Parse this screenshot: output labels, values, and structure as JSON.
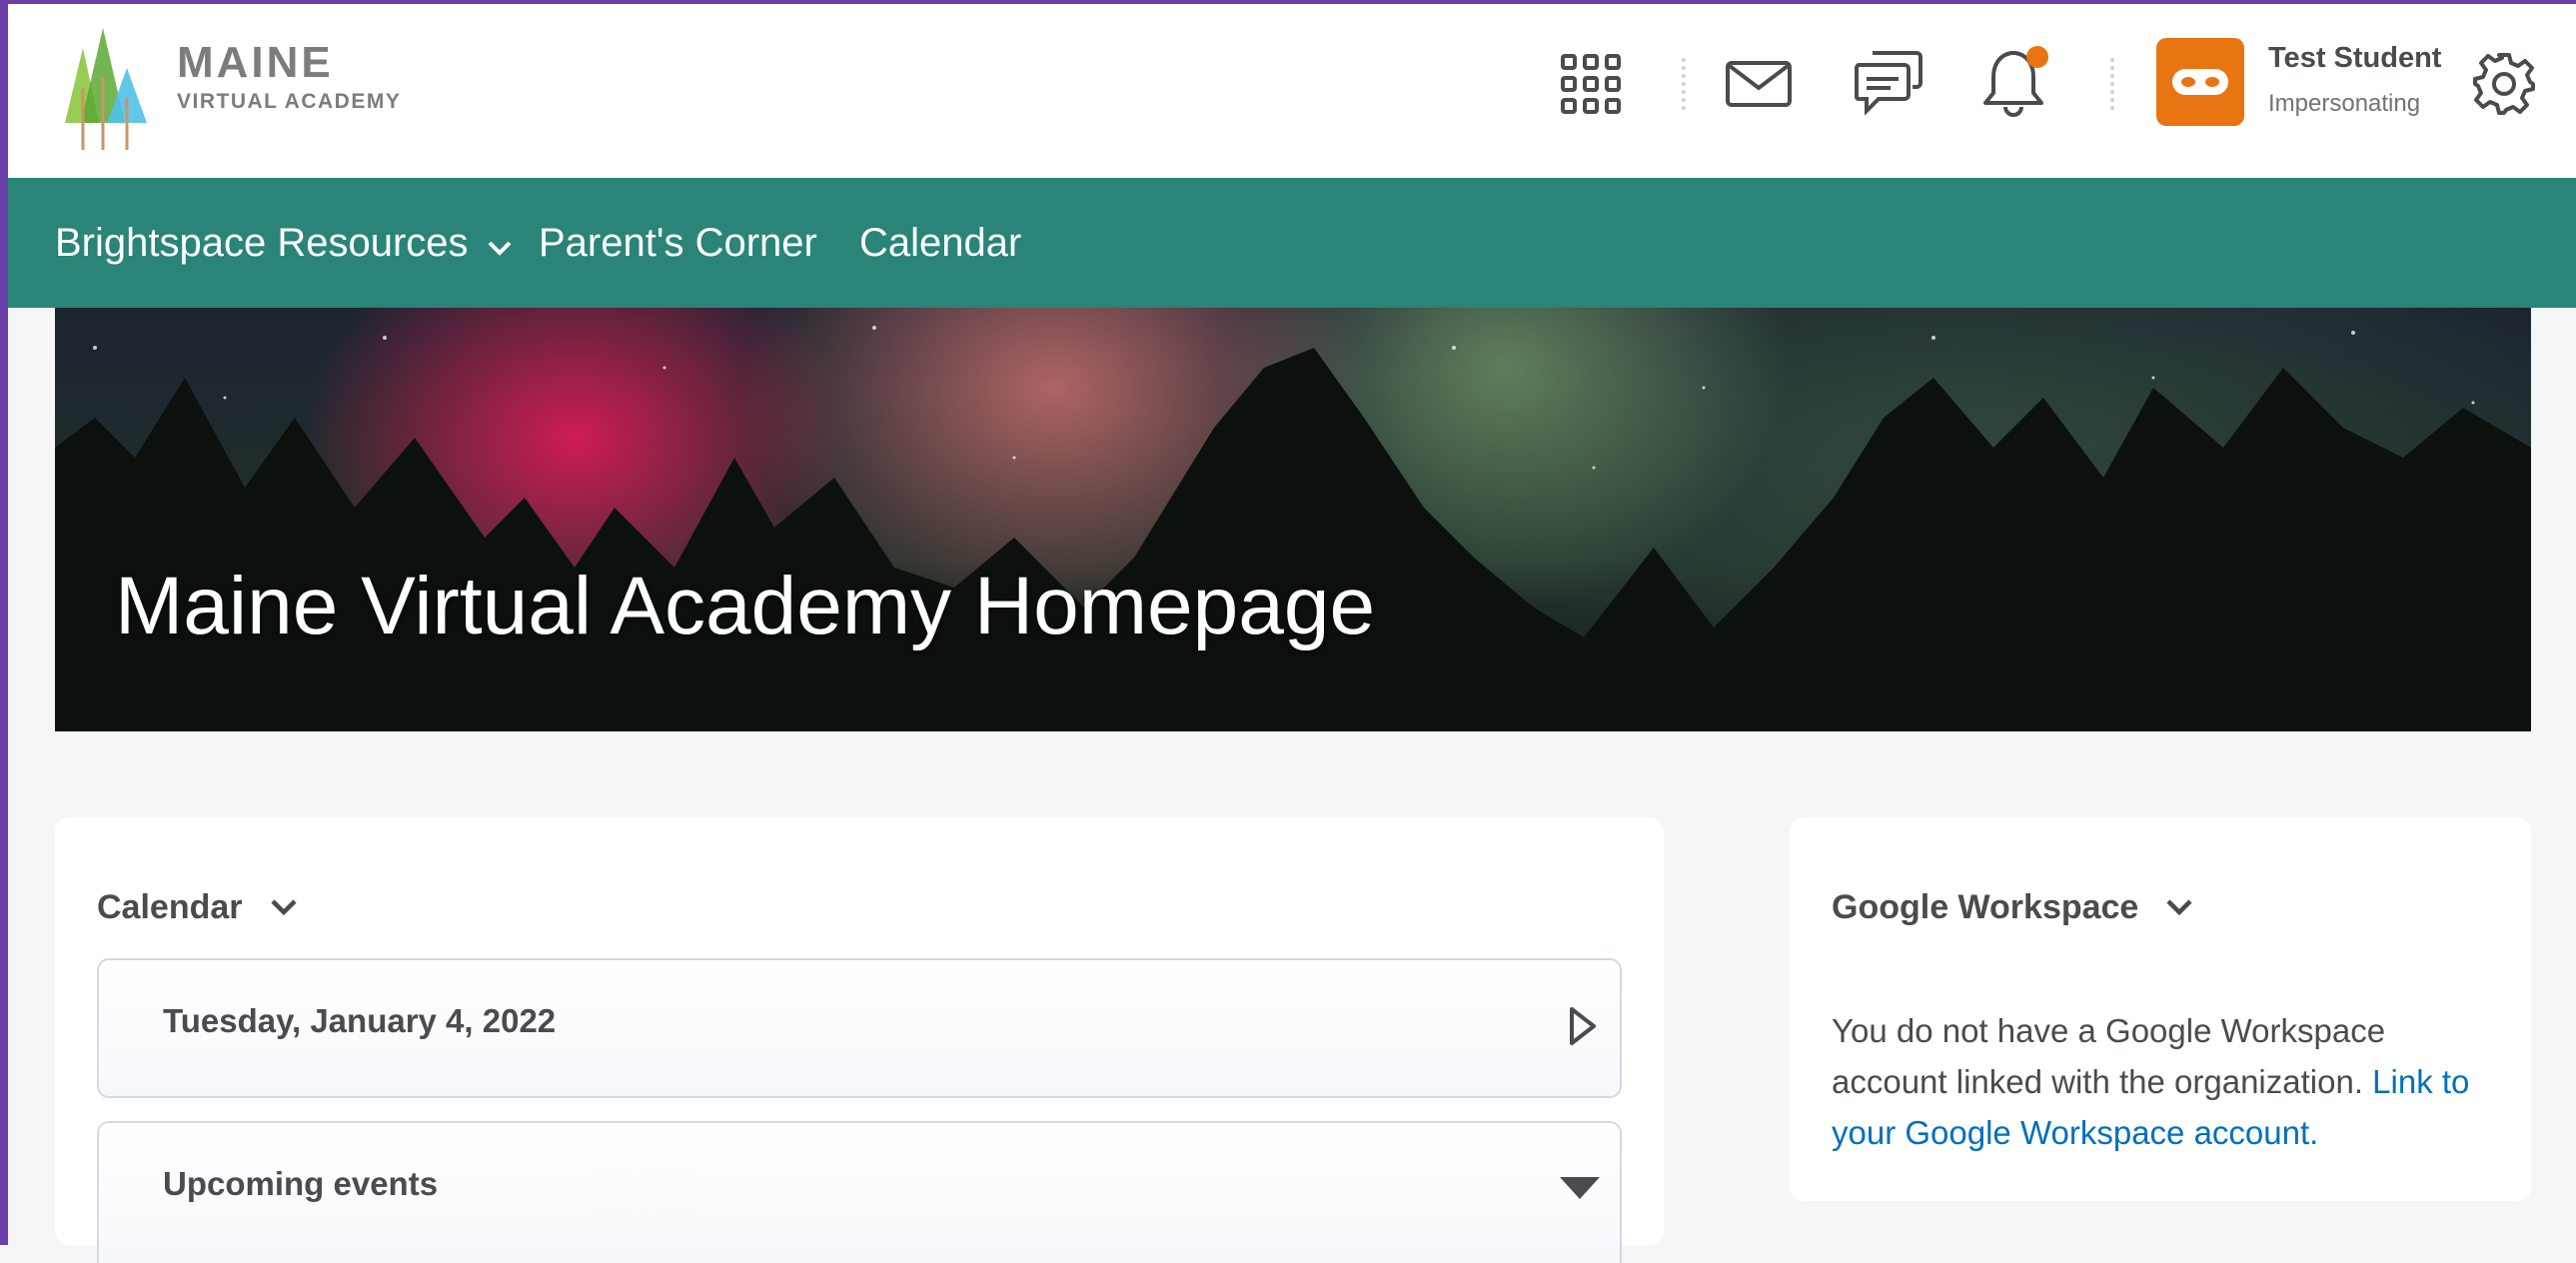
{
  "logo": {
    "title": "MAINE",
    "subtitle": "VIRTUAL ACADEMY"
  },
  "user": {
    "name": "Test Student",
    "role": "Impersonating"
  },
  "nav": {
    "items": [
      {
        "label": "Brightspace Resources",
        "has_dropdown": true
      },
      {
        "label": "Parent's Corner"
      },
      {
        "label": "Calendar"
      }
    ]
  },
  "banner": {
    "title": "Maine Virtual Academy Homepage"
  },
  "calendar_widget": {
    "title": "Calendar",
    "date_label": "Tuesday, January 4, 2022",
    "upcoming_label": "Upcoming events"
  },
  "google_widget": {
    "title": "Google Workspace",
    "message": "You do not have a Google Workspace account linked with the organization.",
    "link": "Link to your Google Workspace account."
  },
  "colors": {
    "accent_teal": "#2a8478",
    "avatar_orange": "#e87511",
    "link_blue": "#006fbf",
    "notification_dot": "#e87511"
  },
  "icons": [
    "apps-grid-icon",
    "mail-icon",
    "chat-icon",
    "bell-icon",
    "incognito-icon",
    "gear-icon",
    "chevron-down-icon",
    "triangle-right-icon",
    "triangle-down-icon"
  ]
}
